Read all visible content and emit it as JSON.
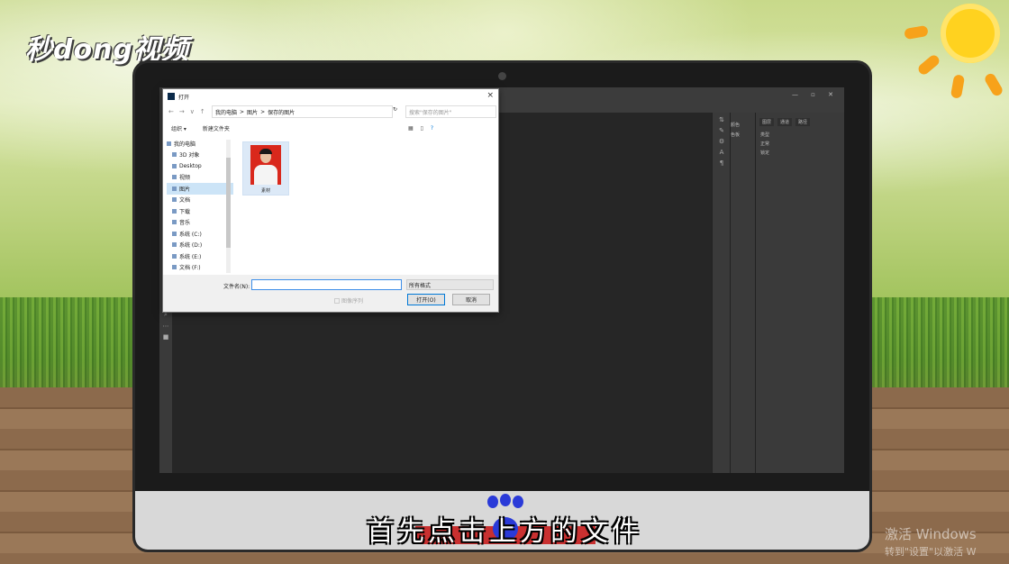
{
  "brand": {
    "logo": "秒dong视频"
  },
  "dialog": {
    "title": "打开",
    "close": "×",
    "nav": {
      "back": "←",
      "forward": "→",
      "down": "∨",
      "up": "↑"
    },
    "path": [
      "我的电脑",
      "图片",
      "保存的图片"
    ],
    "path_sep": ">",
    "refresh": "↻",
    "search_placeholder": "搜索\"保存的图片\"",
    "toolbar": {
      "organize": "组织 ▾",
      "new_folder": "新建文件夹"
    },
    "sidebar": [
      {
        "label": "我的电脑"
      },
      {
        "label": "3D 对象"
      },
      {
        "label": "Desktop"
      },
      {
        "label": "视频"
      },
      {
        "label": "图片"
      },
      {
        "label": "文档"
      },
      {
        "label": "下载"
      },
      {
        "label": "音乐"
      },
      {
        "label": "系统 (C:)"
      },
      {
        "label": "系统 (D:)"
      },
      {
        "label": "系统 (E:)"
      },
      {
        "label": "文档 (F:)"
      }
    ],
    "file": {
      "name": "素材"
    },
    "filename_label": "文件名(N):",
    "filename_value": "",
    "filetype": "所有格式",
    "image_sequence": "图像序列",
    "open_button": "打开(O)",
    "cancel_button": "取消"
  },
  "photoshop": {
    "panel_tabs": [
      "图层",
      "通道",
      "路径"
    ],
    "mid_items": [
      "颜色",
      "色板"
    ],
    "kind_label": "类型",
    "blend_label": "正常",
    "opacity_label": "不透明度",
    "lock_label": "锁定",
    "fill_label": "填充"
  },
  "caption": "首先点击上方的文件",
  "watermark": {
    "line1": "激活 Windows",
    "line2": "转到\"设置\"以激活 W"
  },
  "colors": {
    "accent": "#0078d7",
    "caption_red": "#c81e1e",
    "paw_blue": "#2a3ad8"
  }
}
